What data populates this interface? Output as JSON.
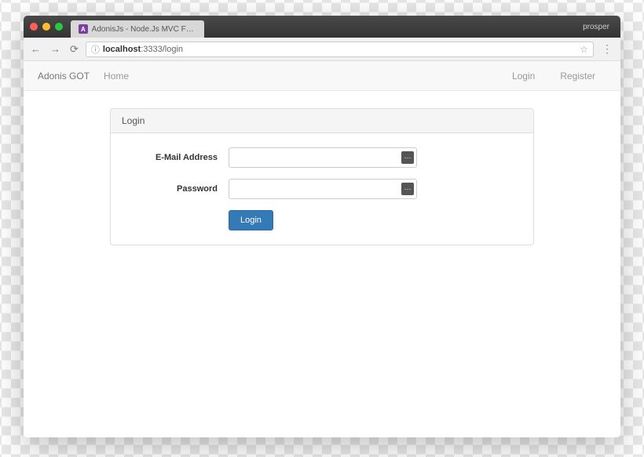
{
  "browser": {
    "tab_title": "AdonisJs - Node.Js MVC Fram",
    "user_badge": "prosper",
    "url_host": "localhost",
    "url_port_path": ":3333/login"
  },
  "navbar": {
    "brand": "Adonis GOT",
    "home": "Home",
    "login": "Login",
    "register": "Register"
  },
  "panel": {
    "title": "Login",
    "email_label": "E-Mail Address",
    "password_label": "Password",
    "submit": "Login"
  }
}
